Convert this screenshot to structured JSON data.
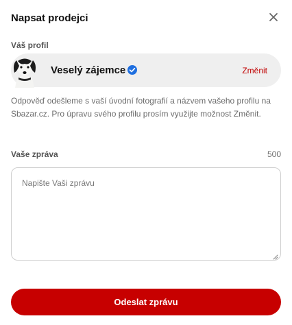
{
  "dialog": {
    "title": "Napsat prodejci",
    "close_icon": "close-icon"
  },
  "profile": {
    "label": "Váš profil",
    "name": "Veselý zájemce",
    "verified_icon": "verified-check-icon",
    "change_label": "Změnit",
    "info_text": "Odpověď odešleme s vaší úvodní fotografií a názvem vašeho profilu na Sbazar.cz. Pro úpravu svého profilu prosím využijte možnost Změnit."
  },
  "message": {
    "label": "Vaše zpráva",
    "char_counter": "500",
    "placeholder": "Napište Vaši zprávu",
    "value": ""
  },
  "actions": {
    "submit_label": "Odeslat zprávu"
  },
  "colors": {
    "accent": "#c70000",
    "link": "#c00000",
    "verified": "#1f6fe0",
    "pill_bg": "#efefef"
  }
}
